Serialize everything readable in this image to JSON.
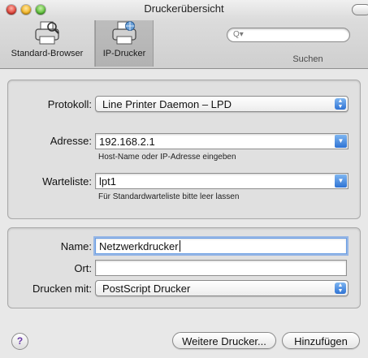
{
  "window": {
    "title": "Druckerübersicht"
  },
  "toolbar": {
    "items": [
      {
        "label": "Standard-Browser",
        "icon": "printer-browser-icon",
        "selected": false
      },
      {
        "label": "IP-Drucker",
        "icon": "ip-printer-icon",
        "selected": true
      }
    ],
    "search": {
      "placeholder": "",
      "glyph": "Q▾",
      "label": "Suchen"
    }
  },
  "connection": {
    "protocol_label": "Protokoll:",
    "protocol_value": "Line Printer Daemon – LPD",
    "address_label": "Adresse:",
    "address_value": "192.168.2.1",
    "address_hint": "Host-Name oder IP-Adresse eingeben",
    "queue_label": "Warteliste:",
    "queue_value": "lpt1",
    "queue_hint": "Für Standardwarteliste bitte leer lassen"
  },
  "printer": {
    "name_label": "Name:",
    "name_value": "Netzwerkdrucker",
    "location_label": "Ort:",
    "location_value": "",
    "driver_label": "Drucken mit:",
    "driver_value": "PostScript Drucker"
  },
  "buttons": {
    "help": "?",
    "more_printers": "Weitere Drucker...",
    "add": "Hinzufügen"
  },
  "colors": {
    "accent": "#2f73d4",
    "focus_ring": "#6a9ee4"
  }
}
